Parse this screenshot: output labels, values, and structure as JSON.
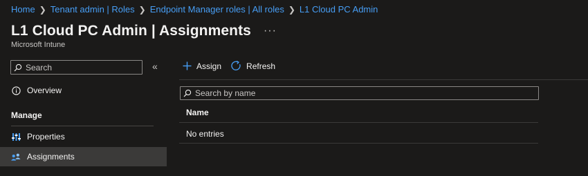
{
  "breadcrumb": [
    {
      "label": "Home"
    },
    {
      "label": "Tenant admin | Roles"
    },
    {
      "label": "Endpoint Manager roles | All roles"
    },
    {
      "label": "L1 Cloud PC Admin"
    }
  ],
  "header": {
    "title": "L1 Cloud PC Admin | Assignments",
    "more_label": "···",
    "subtitle": "Microsoft Intune"
  },
  "sidebar": {
    "search_placeholder": "Search",
    "collapse_label": "«",
    "overview_label": "Overview",
    "section_label": "Manage",
    "items": [
      {
        "label": "Properties",
        "icon": "properties-icon"
      },
      {
        "label": "Assignments",
        "icon": "assignments-icon",
        "selected": true
      }
    ]
  },
  "toolbar": {
    "assign_label": "Assign",
    "refresh_label": "Refresh"
  },
  "main": {
    "search_placeholder": "Search by name",
    "columns": [
      "Name"
    ],
    "empty_text": "No entries"
  },
  "colors": {
    "background": "#1b1a19",
    "link": "#479ef5",
    "accent": "#479ef5",
    "selected_bg": "#3b3a39",
    "text": "#f3f2f1"
  }
}
